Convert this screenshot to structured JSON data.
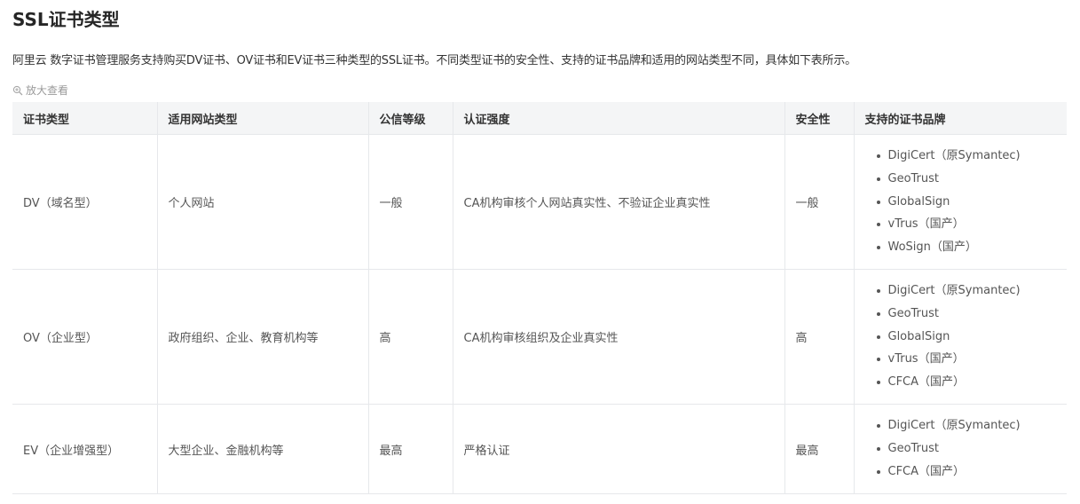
{
  "title": "SSL证书类型",
  "intro": "阿里云 数字证书管理服务支持购买DV证书、OV证书和EV证书三种类型的SSL证书。不同类型证书的安全性、支持的证书品牌和适用的网站类型不同，具体如下表所示。",
  "zoom": {
    "icon": "zoom-in-icon",
    "label": "放大查看"
  },
  "table": {
    "headers": [
      "证书类型",
      "适用网站类型",
      "公信等级",
      "认证强度",
      "安全性",
      "支持的证书品牌"
    ],
    "rows": [
      {
        "type": "DV（域名型）",
        "site": "个人网站",
        "trust": "一般",
        "auth": "CA机构审核个人网站真实性、不验证企业真实性",
        "security": "一般",
        "brands": [
          "DigiCert（原Symantec)",
          "GeoTrust",
          "GlobalSign",
          "vTrus（国产）",
          "WoSign（国产）"
        ]
      },
      {
        "type": "OV（企业型）",
        "site": "政府组织、企业、教育机构等",
        "trust": "高",
        "auth": "CA机构审核组织及企业真实性",
        "security": "高",
        "brands": [
          "DigiCert（原Symantec)",
          "GeoTrust",
          "GlobalSign",
          "vTrus（国产）",
          "CFCA（国产）"
        ]
      },
      {
        "type": "EV（企业增强型）",
        "site": "大型企业、金融机构等",
        "trust": "最高",
        "auth": "严格认证",
        "security": "最高",
        "brands": [
          "DigiCert（原Symantec)",
          "GeoTrust",
          "CFCA（国产）"
        ]
      }
    ]
  }
}
